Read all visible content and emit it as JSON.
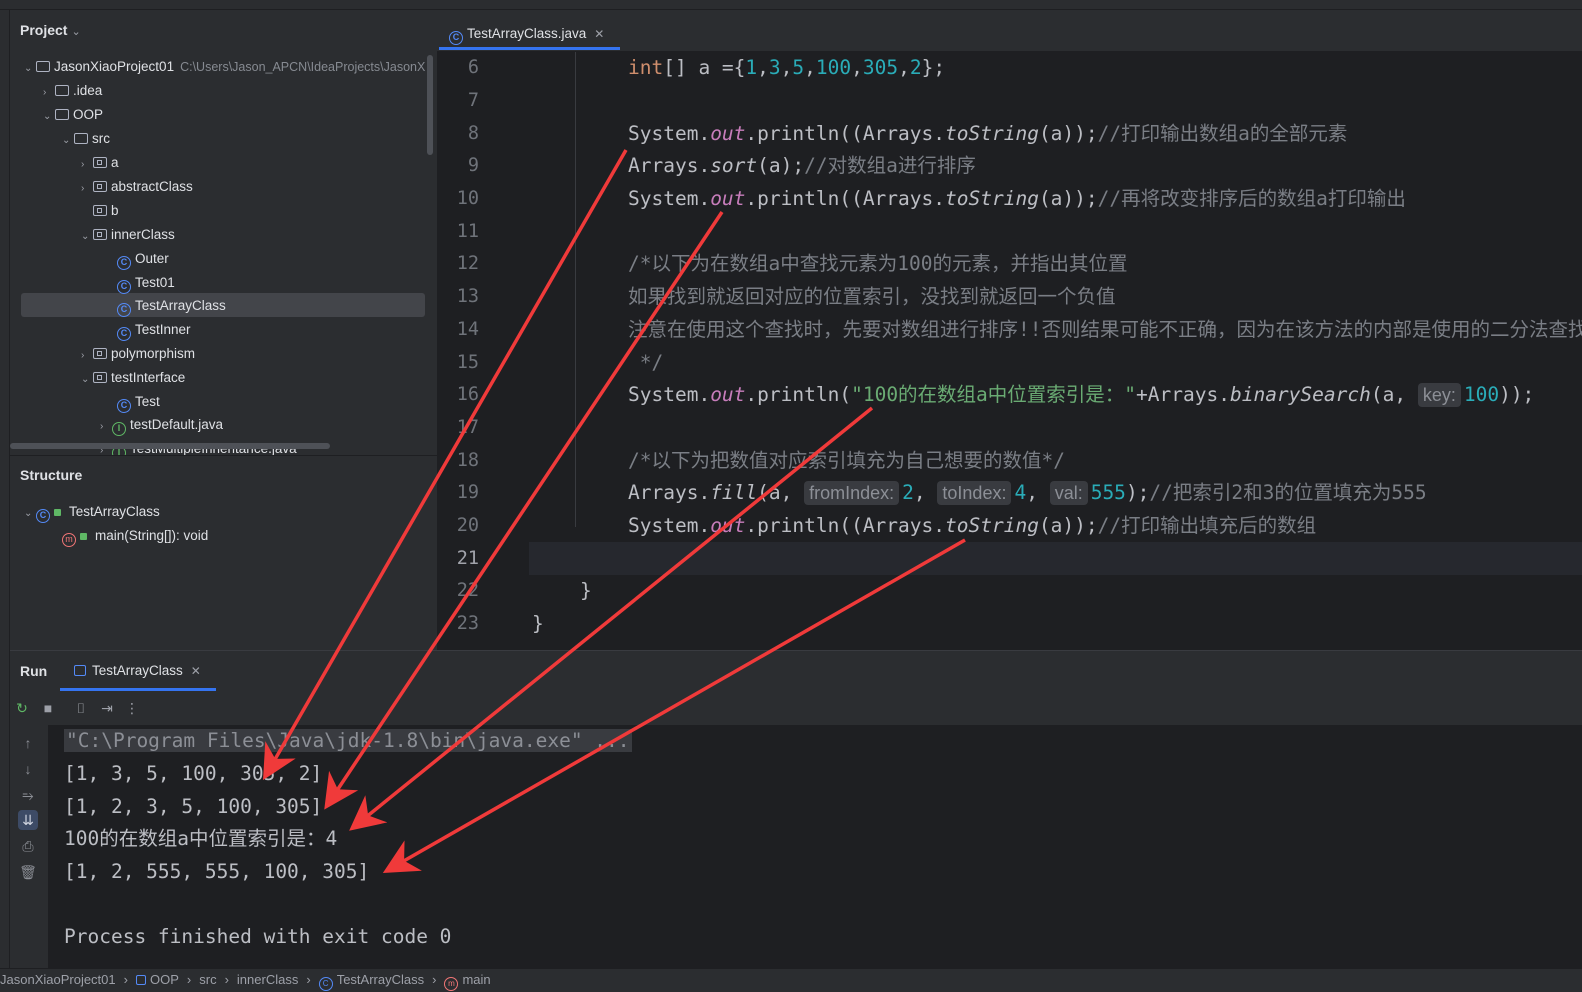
{
  "project": {
    "header": "Project",
    "tree": [
      {
        "label": "JasonXiaoProject01",
        "path": "C:\\Users\\Jason_APCN\\IdeaProjects\\JasonX",
        "kind": "module",
        "expanded": true
      },
      {
        "label": ".idea",
        "kind": "folder"
      },
      {
        "label": "OOP",
        "kind": "module",
        "expanded": true
      },
      {
        "label": "src",
        "kind": "folder",
        "expanded": true
      },
      {
        "label": "a",
        "kind": "package"
      },
      {
        "label": "abstractClass",
        "kind": "package"
      },
      {
        "label": "b",
        "kind": "package"
      },
      {
        "label": "innerClass",
        "kind": "package",
        "expanded": true
      },
      {
        "label": "Outer",
        "kind": "class"
      },
      {
        "label": "Test01",
        "kind": "class"
      },
      {
        "label": "TestArrayClass",
        "kind": "class",
        "selected": true
      },
      {
        "label": "TestInner",
        "kind": "class"
      },
      {
        "label": "polymorphism",
        "kind": "package"
      },
      {
        "label": "testInterface",
        "kind": "package",
        "expanded": true
      },
      {
        "label": "Test",
        "kind": "class"
      },
      {
        "label": "testDefault.java",
        "kind": "interface"
      },
      {
        "label": "TestMultipleInheritance.java",
        "kind": "interface"
      }
    ]
  },
  "structure": {
    "header": "Structure",
    "class_name": "TestArrayClass",
    "method": "main(String[]): void"
  },
  "editor": {
    "tab_label": "TestArrayClass.java",
    "line_numbers": [
      "6",
      "7",
      "8",
      "9",
      "10",
      "11",
      "12",
      "13",
      "14",
      "15",
      "16",
      "17",
      "18",
      "19",
      "20",
      "21",
      "22",
      "23"
    ],
    "current_line": "21",
    "code": {
      "l6": {
        "kw": "int",
        "a": "[] a ={",
        "n1": "1",
        "n2": "3",
        "n3": "5",
        "n4": "100",
        "n5": "305",
        "n6": "2",
        "end": "};"
      },
      "l8": {
        "a": "System.",
        "f": "out",
        "b": ".println((Arrays.",
        "m": "toString",
        "c": "(a));",
        "cmt": "//打印输出数组a的全部元素"
      },
      "l9": {
        "a": "Arrays.",
        "m": "sort",
        "c": "(a);",
        "cmt": "//对数组a进行排序"
      },
      "l10": {
        "a": "System.",
        "f": "out",
        "b": ".println((Arrays.",
        "m": "toString",
        "c": "(a));",
        "cmt": "//再将改变排序后的数组a打印输出"
      },
      "l12": "/*以下为在数组a中查找元素为100的元素，并指出其位置",
      "l13": "如果找到就返回对应的位置索引，没找到就返回一个负值",
      "l14": "注意在使用这个查找时，先要对数组进行排序!!否则结果可能不正确，因为在该方法的内部是使用的二分法查找的",
      "l15": " */",
      "l16": {
        "a": "System.",
        "f": "out",
        "b": ".println(",
        "s": "\"100的在数组a中位置索引是：\"",
        "c": "+Arrays.",
        "m": "binarySearch",
        "d": "(a, ",
        "hint": "key:",
        "n": "100",
        "e": "));"
      },
      "l18": "/*以下为把数值对应索引填充为自己想要的数值*/",
      "l19": {
        "a": "Arrays.",
        "m": "fill",
        "b": "(a, ",
        "h1": "fromIndex:",
        "n1": "2",
        "h2": "toIndex:",
        "n2": "4",
        "h3": "val:",
        "n3": "555",
        "c": ");",
        "cmt": "//把索引2和3的位置填充为555"
      },
      "l20": {
        "a": "System.",
        "f": "out",
        "b": ".println((Arrays.",
        "m": "toString",
        "c": "(a));",
        "cmt": "//打印输出填充后的数组"
      },
      "l22": "}",
      "l23": "}"
    }
  },
  "run": {
    "label": "Run",
    "tab_label": "TestArrayClass",
    "output": [
      "\"C:\\Program Files\\Java\\jdk-1.8\\bin\\java.exe\" ...",
      "[1, 3, 5, 100, 305, 2]",
      "[1, 2, 3, 5, 100, 305]",
      "100的在数组a中位置索引是：4",
      "[1, 2, 555, 555, 100, 305]",
      "",
      "Process finished with exit code 0"
    ]
  },
  "statusbar": {
    "crumbs": [
      "JasonXiaoProject01",
      "OOP",
      "src",
      "innerClass",
      "TestArrayClass",
      "main"
    ]
  },
  "colors": {
    "annotation_arrow": "#f03a3a",
    "accent": "#3574f0"
  }
}
